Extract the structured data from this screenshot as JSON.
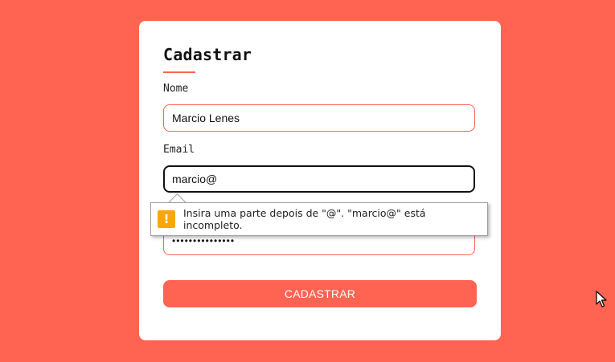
{
  "colors": {
    "background": "#ff6351",
    "card": "#ffffff",
    "accent": "#ff6351",
    "warning": "#f8a60a"
  },
  "form": {
    "title": "Cadastrar",
    "name_label": "Nome",
    "name_value": "Marcio Lenes",
    "email_label": "Email",
    "email_value": "marcio@",
    "password_value": "•••••••••••••••",
    "submit_label": "CADASTRAR"
  },
  "validation_tooltip": {
    "icon": "warning-icon",
    "icon_glyph": "!",
    "message": "Insira uma parte depois de \"@\". \"marcio@\" está incompleto."
  }
}
